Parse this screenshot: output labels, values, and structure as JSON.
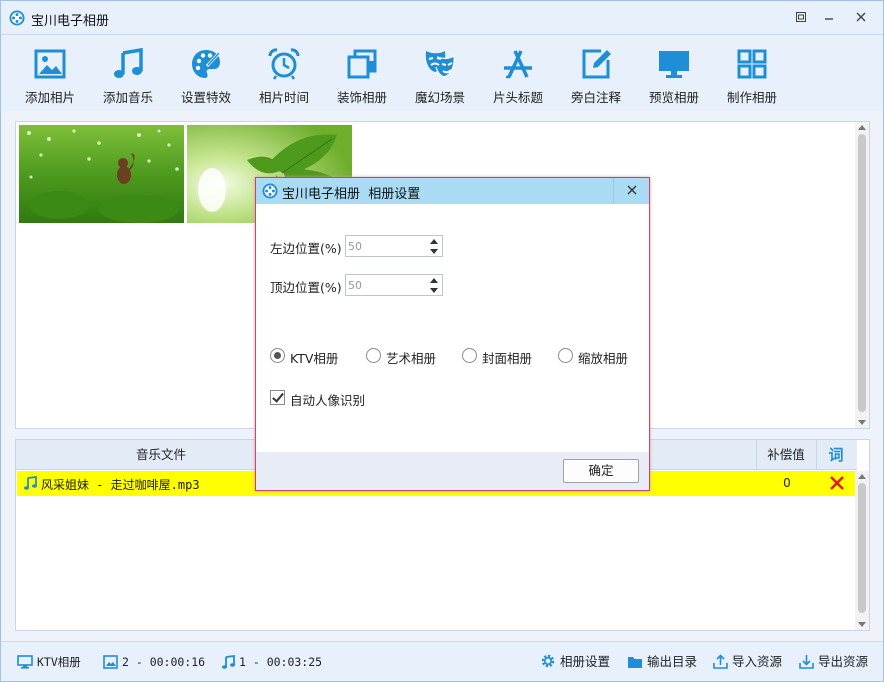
{
  "window": {
    "title": "宝川电子相册"
  },
  "toolbar": {
    "items": [
      {
        "label": "添加相片",
        "icon": "image-icon"
      },
      {
        "label": "添加音乐",
        "icon": "music-note-icon"
      },
      {
        "label": "设置特效",
        "icon": "palette-icon"
      },
      {
        "label": "相片时间",
        "icon": "alarm-clock-icon"
      },
      {
        "label": "装饰相册",
        "icon": "layers-icon"
      },
      {
        "label": "魔幻场景",
        "icon": "theater-mask-icon"
      },
      {
        "label": "片头标题",
        "icon": "app-store-a-icon"
      },
      {
        "label": "旁白注释",
        "icon": "edit-note-icon"
      },
      {
        "label": "预览相册",
        "icon": "monitor-icon"
      },
      {
        "label": "制作相册",
        "icon": "grid-icon"
      }
    ],
    "accent": "#1e8fd6"
  },
  "music_table": {
    "headers": {
      "file": "音乐文件",
      "comp": "补偿值",
      "lyrics": "词"
    },
    "rows": [
      {
        "name": "风采姐妹 - 走过咖啡屋.mp3",
        "comp": "0"
      }
    ],
    "highlight": "#ffff00"
  },
  "dialog": {
    "app": "宝川电子相册",
    "title": "相册设置",
    "left_label": "左边位置(%)",
    "left_value": "50",
    "top_label": "顶边位置(%)",
    "top_value": "50",
    "modes": [
      {
        "label": "KTV相册",
        "checked": true
      },
      {
        "label": "艺术相册",
        "checked": false
      },
      {
        "label": "封面相册",
        "checked": false
      },
      {
        "label": "缩放相册",
        "checked": false
      }
    ],
    "face_detect": {
      "label": "自动人像识别",
      "checked": true
    },
    "ok": "确定"
  },
  "status": {
    "mode": "KTV相册",
    "photos": "2 - 00:00:16",
    "music": "1 - 00:03:25",
    "settings": "相册设置",
    "output": "输出目录",
    "import": "导入资源",
    "export": "导出资源"
  }
}
